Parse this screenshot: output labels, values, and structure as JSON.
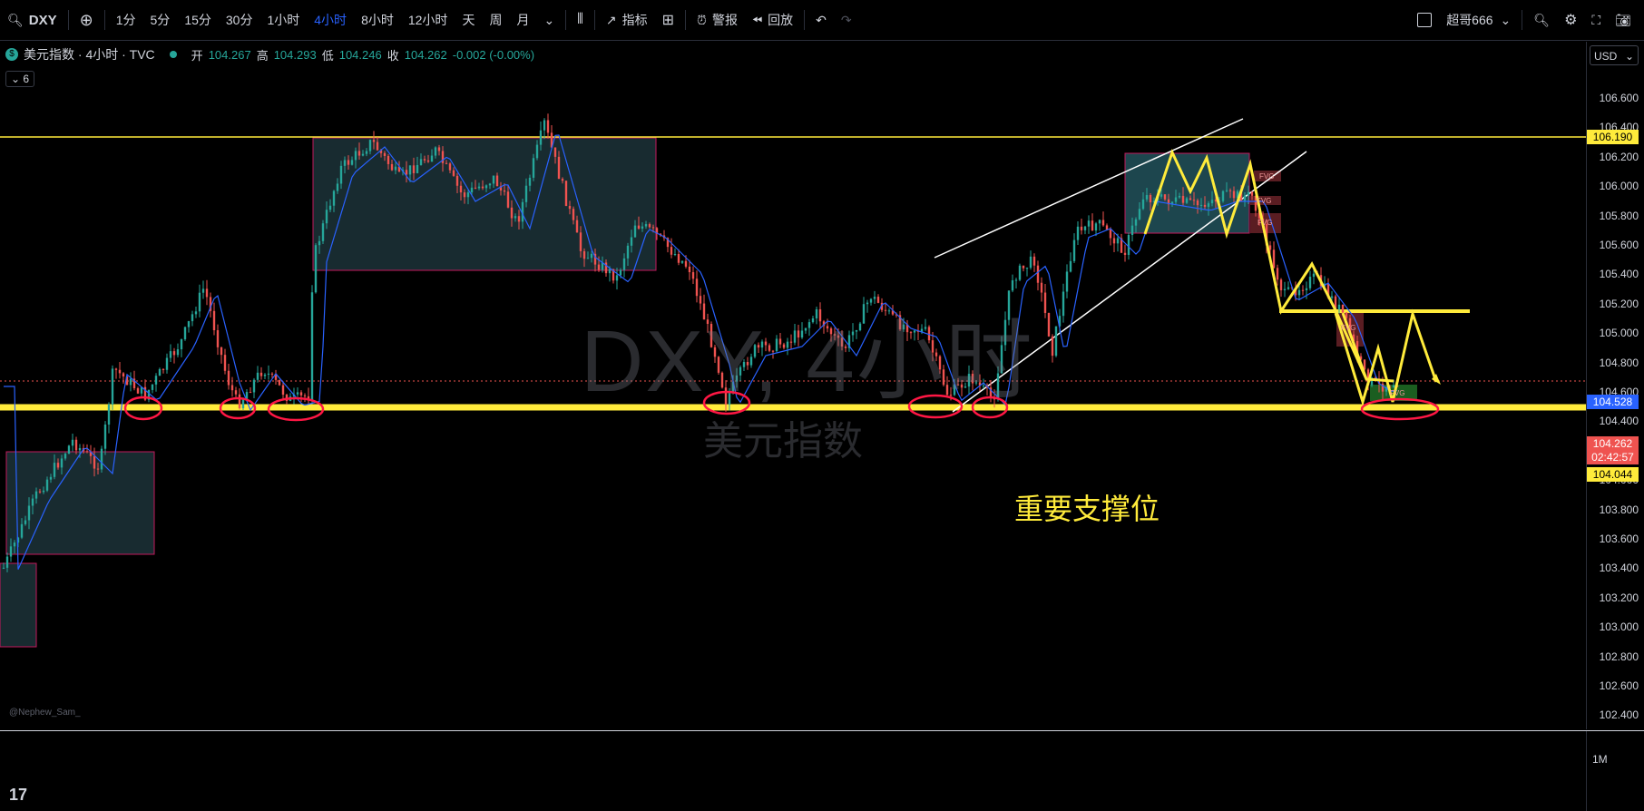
{
  "toolbar": {
    "symbol": "DXY",
    "intervals": [
      "1分",
      "5分",
      "15分",
      "30分",
      "1小时",
      "4小时",
      "8小时",
      "12小时",
      "天",
      "周",
      "月"
    ],
    "active_interval": "4小时",
    "indicators": "指标",
    "alert": "警报",
    "replay": "回放",
    "layout_name": "超哥666"
  },
  "legend": {
    "title": "美元指数 · 4小时 · TVC",
    "open_label": "开",
    "open": "104.267",
    "high_label": "高",
    "high": "104.293",
    "low_label": "低",
    "low": "104.246",
    "close_label": "收",
    "close": "104.262",
    "change": "-0.002 (-0.00%)",
    "indicator_count": "6"
  },
  "watermark": {
    "symbol": "DXY, 4小时",
    "name": "美元指数"
  },
  "annotation": "重要支撑位",
  "author": "@Nephew_Sam_",
  "price_axis": {
    "currency": "USD",
    "ticks": [
      "106.600",
      "106.400",
      "106.200",
      "106.000",
      "105.800",
      "105.600",
      "105.400",
      "105.200",
      "105.000",
      "104.800",
      "104.600",
      "104.400",
      "104.200",
      "104.000",
      "103.800",
      "103.600",
      "103.400",
      "103.200",
      "103.000",
      "102.800",
      "102.600",
      "102.400"
    ],
    "label_resistance": "106.190",
    "label_ma": "104.528",
    "label_last": "104.262",
    "label_timer": "02:42:57",
    "label_support": "104.044"
  },
  "volume_label": "1M",
  "logo": "17",
  "fvg_tag": "FVG",
  "colors": {
    "support": "#ffeb3b",
    "resistance": "#ffeb3b",
    "ma": "#2962ff",
    "up": "#26a69a",
    "down": "#ef5350",
    "zone": "#2c4f57"
  }
}
